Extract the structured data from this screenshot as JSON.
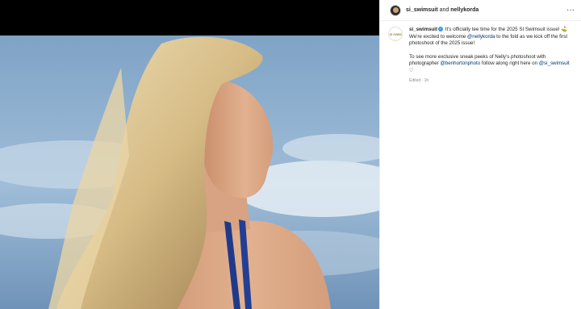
{
  "header": {
    "account": "si_swimsuit",
    "joiner": " and ",
    "collaborator": "nellykorda",
    "more_icon": "more-horizontal-icon"
  },
  "caption": {
    "avatar_text": "SI SWIM",
    "username": "si_swimsuit",
    "text_1": " It's officially tee time for the 2025 SI Swimsuit issue! ⛳ We're excited to welcome ",
    "mention_1": "@nellykorda",
    "text_2": " to the fold as we kick off the first photoshoot of the 2025 issue!",
    "text_3": "To see more exclusive sneak peeks of Nelly's photoshoot with photographer ",
    "mention_2": "@benhortonphoto",
    "text_4": " follow along right here on ",
    "mention_3": "@si_swimsuit",
    "text_5": " ♡",
    "meta": "Edited · 1h"
  },
  "colors": {
    "sky": "#8fb0cf",
    "hair": "#d9c08e",
    "skin": "#d9a684",
    "swimsuit": "#1f3a8a",
    "link": "#00376b",
    "verified": "#3897f0"
  }
}
